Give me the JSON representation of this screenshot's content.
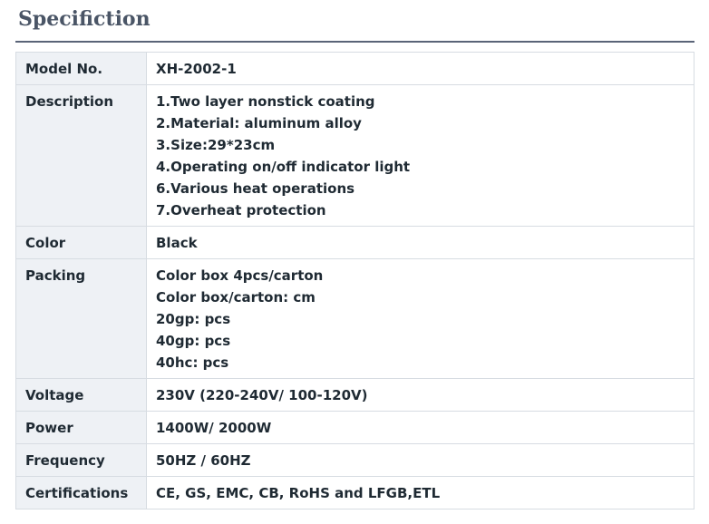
{
  "page": {
    "heading": "Specifiction"
  },
  "spec_table": {
    "rows": [
      {
        "label": "Model No.",
        "values": [
          "XH-2002-1"
        ]
      },
      {
        "label": "Description",
        "values": [
          "1.Two layer nonstick coating",
          "2.Material: aluminum alloy",
          "3.Size:29*23cm",
          "4.Operating on/off indicator light",
          "6.Various heat operations",
          "7.Overheat protection"
        ]
      },
      {
        "label": "Color",
        "values": [
          "Black"
        ]
      },
      {
        "label": "Packing",
        "values": [
          "Color box 4pcs/carton",
          "Color box/carton: cm",
          "20gp: pcs",
          "40gp: pcs",
          "40hc: pcs"
        ]
      },
      {
        "label": "Voltage",
        "values": [
          "230V (220-240V/ 100-120V)"
        ]
      },
      {
        "label": "Power",
        "values": [
          "1400W/ 2000W"
        ]
      },
      {
        "label": "Frequency",
        "values": [
          "50HZ / 60HZ"
        ]
      },
      {
        "label": "Certifications",
        "values": [
          "CE, GS, EMC, CB, RoHS and LFGB,ETL"
        ]
      }
    ]
  },
  "colors": {
    "heading": "#4a5566",
    "rule": "#5a6478",
    "label_bg": "#eef1f5",
    "border": "#d7dce2",
    "text": "#1f2a33"
  }
}
